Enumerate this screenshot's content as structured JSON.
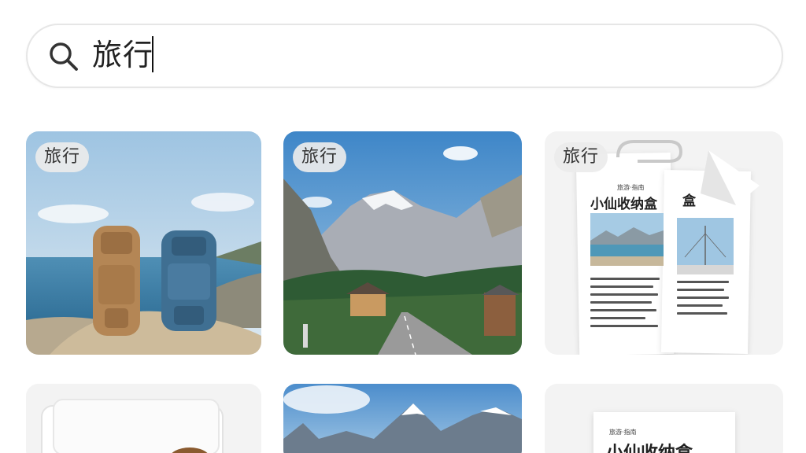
{
  "search": {
    "query": "旅行",
    "icon": "search-icon"
  },
  "cards": [
    {
      "tag": "旅行",
      "subject": "backpacks-on-rock-by-sea"
    },
    {
      "tag": "旅行",
      "subject": "mountain-road-with-house"
    },
    {
      "tag": "旅行",
      "doc_title": "小仙收纳盒",
      "doc_header": "旅游·指南",
      "doc_side_char": "盒"
    },
    {
      "tag": "",
      "subject": "white-paper-folder"
    },
    {
      "tag": "",
      "subject": "mountain-peaks"
    },
    {
      "tag": "",
      "doc_title": "小仙收纳盒",
      "doc_header": "旅游·指南"
    }
  ]
}
